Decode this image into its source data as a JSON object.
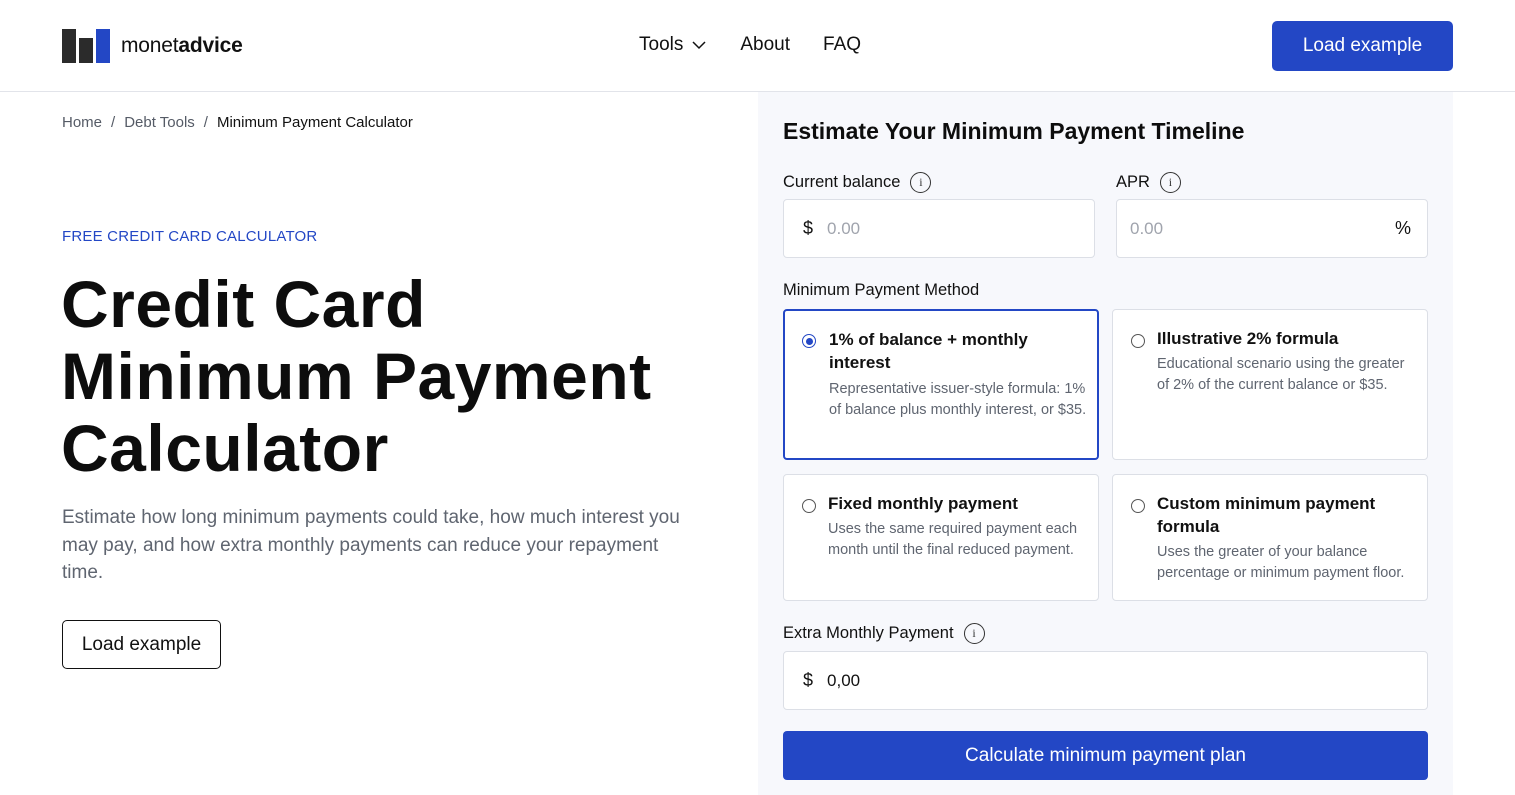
{
  "header": {
    "logo_light": "monet",
    "logo_bold": "advice",
    "nav": [
      {
        "label": "Tools"
      },
      {
        "label": "About"
      },
      {
        "label": "FAQ"
      }
    ],
    "cta_label": "Load example",
    "colors": {
      "accent": "#2347c5",
      "logo_dark": "#2b2b2b"
    }
  },
  "breadcrumb": {
    "items": [
      "Home",
      "Debt Tools",
      "Minimum Payment Calculator"
    ],
    "separator": "/"
  },
  "hero": {
    "eyebrow": "FREE CREDIT CARD CALCULATOR",
    "title_line1": "Credit Card",
    "title_line2": "Minimum Payment",
    "title_line3": "Calculator",
    "description": "Estimate how long minimum payments could take, how much interest you may pay, and how extra monthly payments can reduce your repayment time.",
    "button_label": "Load example"
  },
  "form": {
    "title": "Estimate Your Minimum Payment Timeline",
    "balance": {
      "label": "Current balance",
      "prefix": "$",
      "placeholder": "0.00"
    },
    "apr": {
      "label": "APR",
      "suffix": "%",
      "placeholder": "0.00"
    },
    "method_label": "Minimum Payment Method",
    "methods": [
      {
        "title": "1% of balance + monthly interest",
        "desc": "Representative issuer-style formula: 1% of balance plus monthly interest, or $35.",
        "selected": true
      },
      {
        "title": "Illustrative 2% formula",
        "desc": "Educational scenario using the greater of 2% of the current balance or $35.",
        "selected": false
      },
      {
        "title": "Fixed monthly payment",
        "desc": "Uses the same required payment each month until the final reduced payment.",
        "selected": false
      },
      {
        "title": "Custom minimum payment formula",
        "desc": "Uses the greater of your balance percentage or minimum payment floor.",
        "selected": false
      }
    ],
    "extra": {
      "label": "Extra Monthly Payment",
      "prefix": "$",
      "value": "0,00"
    },
    "submit_label": "Calculate minimum payment plan"
  }
}
